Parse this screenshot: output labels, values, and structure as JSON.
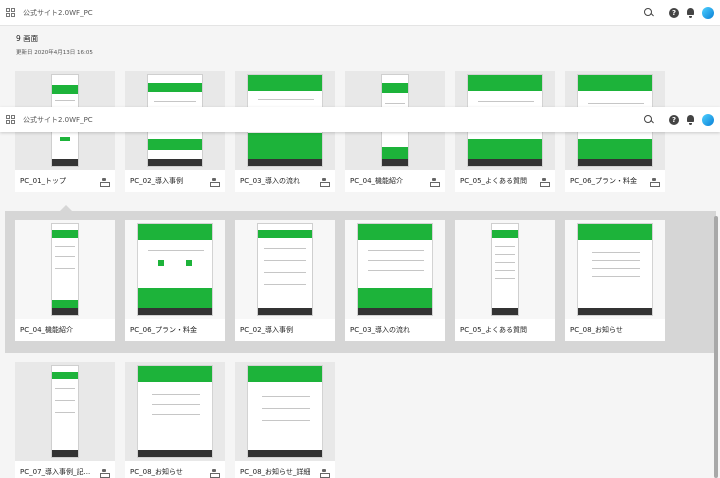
{
  "app_title": "公式サイト2.0WF_PC",
  "header": {
    "screen_count": "9 画面",
    "updated": "更新日 2020年4月13日 16:05"
  },
  "colors": {
    "accent": "#1db33a",
    "panel": "#d6d6d6"
  },
  "icons": [
    "grid-icon",
    "search-icon",
    "help-icon",
    "bell-icon",
    "avatar",
    "share-icon"
  ],
  "help_glyph": "?",
  "row1": [
    "PC_01_トップ",
    "PC_02_導入事例",
    "PC_03_導入の流れ",
    "PC_04_機能紹介",
    "PC_05_よくある質問",
    "PC_06_プラン・料金"
  ],
  "group": [
    "PC_04_機能紹介",
    "PC_06_プラン・料金",
    "PC_02_導入事例",
    "PC_03_導入の流れ",
    "PC_05_よくある質問",
    "PC_08_お知らせ"
  ],
  "row3": [
    "PC_07_導入事例_記...",
    "PC_08_お知らせ",
    "PC_08_お知らせ_詳細"
  ]
}
